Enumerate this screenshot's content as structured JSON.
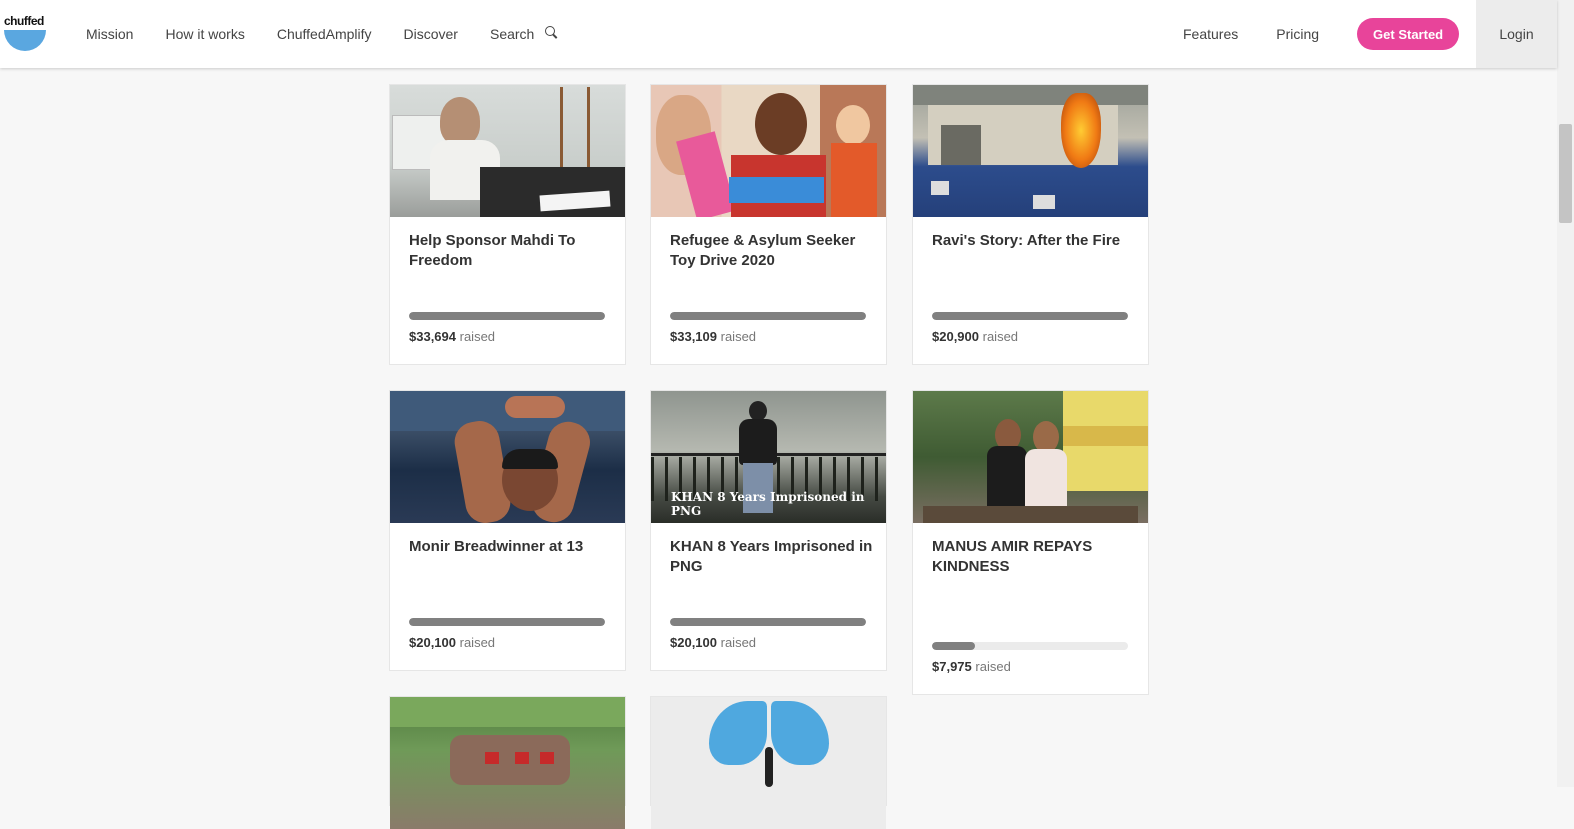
{
  "header": {
    "logo_text": "chuffed",
    "nav_left": [
      "Mission",
      "How it works",
      "ChuffedAmplify",
      "Discover"
    ],
    "search_label": "Search",
    "nav_right": [
      "Features",
      "Pricing"
    ],
    "cta_label": "Get Started",
    "login_label": "Login"
  },
  "raised_suffix": "raised",
  "campaigns": [
    {
      "title": "Help Sponsor Mahdi To Freedom",
      "amount": "$33,694",
      "progress": 1.0
    },
    {
      "title": "Refugee & Asylum Seeker Toy Drive 2020",
      "amount": "$33,109",
      "progress": 1.0
    },
    {
      "title": "Ravi's Story: After the Fire",
      "amount": "$20,900",
      "progress": 1.0
    },
    {
      "title": "Monir Breadwinner at 13",
      "amount": "$20,100",
      "progress": 1.0
    },
    {
      "title": "KHAN 8 Years Imprisoned in PNG",
      "amount": "$20,100",
      "progress": 1.0,
      "image_caption": "KHAN 8 Years Imprisoned in PNG"
    },
    {
      "title": "MANUS AMIR REPAYS KINDNESS",
      "amount": "$7,975",
      "progress": 0.22
    }
  ],
  "colors": {
    "accent": "#e8449a",
    "logo_blue": "#5aa7e0",
    "progress": "#808080"
  }
}
